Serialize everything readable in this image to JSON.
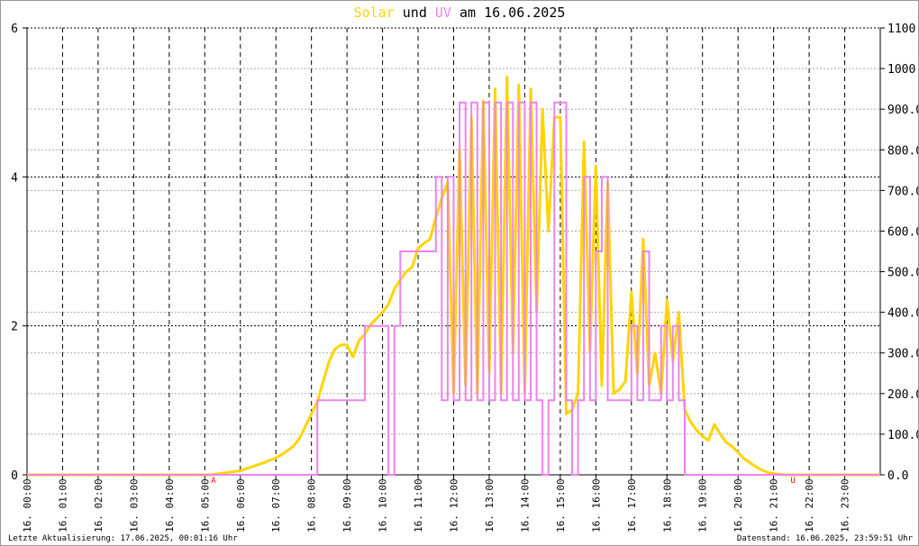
{
  "chart_data": {
    "type": "line",
    "title_parts": {
      "solar": "Solar",
      "und": "und",
      "uv": "UV",
      "rest": "am 16.06.2025"
    },
    "colors": {
      "solar": "#ffd400",
      "uv": "#ee82ee",
      "marker": "#ff0000"
    },
    "x_tick_labels": [
      "16. 00:00",
      "16. 01:00",
      "16. 02:00",
      "16. 03:00",
      "16. 04:00",
      "16. 05:00",
      "16. 06:00",
      "16. 07:00",
      "16. 08:00",
      "16. 09:00",
      "16. 10:00",
      "16. 11:00",
      "16. 12:00",
      "16. 13:00",
      "16. 14:00",
      "16. 15:00",
      "16. 16:00",
      "16. 17:00",
      "16. 18:00",
      "16. 19:00",
      "16. 20:00",
      "16. 21:00",
      "16. 22:00",
      "16. 23:00"
    ],
    "x_range_hours": [
      0,
      24
    ],
    "sample_interval_minutes": 10,
    "left_axis": {
      "label": "UV",
      "ylim": [
        0,
        6
      ],
      "ticks": [
        "0",
        "2",
        "4",
        "6"
      ]
    },
    "right_axis": {
      "label": "Solar",
      "ylim": [
        0,
        1100
      ],
      "ticks": [
        "0.0",
        "100.0",
        "200.0",
        "300.0",
        "400.0",
        "500.0",
        "600.0",
        "700.0",
        "800.0",
        "900.0",
        "1000.0",
        "1100"
      ]
    },
    "markers": [
      {
        "label": "A",
        "hour": 5.25
      },
      {
        "label": "U",
        "hour": 21.55
      }
    ],
    "series": [
      {
        "name": "Solar",
        "axis": "right",
        "values": [
          0,
          0,
          0,
          0,
          0,
          0,
          0,
          0,
          0,
          0,
          0,
          0,
          0,
          0,
          0,
          0,
          0,
          0,
          0,
          0,
          0,
          0,
          0,
          0,
          0,
          0,
          0,
          0,
          0,
          0,
          0,
          0,
          2,
          4,
          6,
          8,
          10,
          15,
          20,
          25,
          30,
          36,
          42,
          50,
          60,
          71,
          90,
          120,
          150,
          180,
          230,
          280,
          310,
          320,
          320,
          290,
          330,
          346,
          370,
          385,
          400,
          420,
          457,
          480,
          500,
          512,
          557,
          570,
          580,
          634,
          680,
          720,
          200,
          800,
          220,
          880,
          200,
          920,
          250,
          950,
          200,
          980,
          300,
          960,
          200,
          950,
          400,
          900,
          600,
          880,
          880,
          150,
          160,
          200,
          820,
          300,
          760,
          220,
          720,
          200,
          210,
          230,
          450,
          250,
          580,
          220,
          300,
          200,
          430,
          280,
          400,
          160,
          130,
          110,
          95,
          85,
          124,
          100,
          80,
          70,
          55,
          40,
          30,
          20,
          12,
          6,
          3,
          1,
          0,
          0,
          0,
          0,
          0,
          0,
          0,
          0,
          0,
          0,
          0,
          0,
          0,
          0,
          0,
          0,
          0
        ]
      },
      {
        "name": "UV",
        "axis": "left",
        "values": [
          0,
          0,
          0,
          0,
          0,
          0,
          0,
          0,
          0,
          0,
          0,
          0,
          0,
          0,
          0,
          0,
          0,
          0,
          0,
          0,
          0,
          0,
          0,
          0,
          0,
          0,
          0,
          0,
          0,
          0,
          0,
          0,
          0,
          0,
          0,
          0,
          0,
          0,
          0,
          0,
          0,
          0,
          0,
          0,
          0,
          0,
          0,
          0,
          0,
          1,
          1,
          1,
          1,
          1,
          1,
          1,
          1,
          2,
          2,
          2,
          2,
          0,
          2,
          3,
          3,
          3,
          3,
          3,
          3,
          4,
          1,
          4,
          1,
          5,
          1,
          5,
          1,
          5,
          1,
          5,
          1,
          5,
          1,
          5,
          1,
          5,
          1,
          0,
          1,
          5,
          5,
          1,
          0,
          1,
          4,
          1,
          3,
          4,
          1,
          1,
          1,
          1,
          2,
          1,
          3,
          1,
          1,
          2,
          1,
          2,
          1,
          0,
          0,
          0,
          0,
          0,
          0,
          0,
          0,
          0,
          0,
          0,
          0,
          0,
          0,
          0,
          0,
          0,
          0,
          0,
          0,
          0,
          0,
          0,
          0,
          0,
          0,
          0,
          0,
          0,
          0,
          0,
          0,
          0,
          0
        ]
      }
    ]
  },
  "footer": {
    "last_update": "Letzte Aktualisierung: 17.06.2025, 00:01:16 Uhr",
    "data_state": "Datenstand: 16.06.2025, 23:59:51 Uhr"
  }
}
